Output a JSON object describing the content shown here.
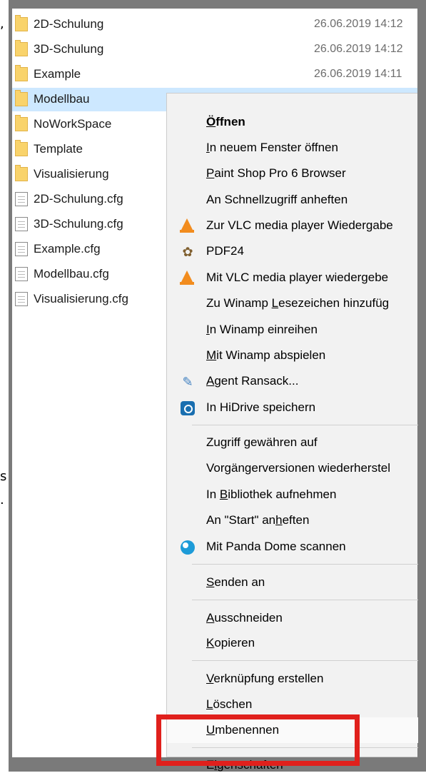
{
  "files": [
    {
      "name": "2D-Schulung",
      "type": "folder",
      "date": "26.06.2019 14:12",
      "selected": false
    },
    {
      "name": "3D-Schulung",
      "type": "folder",
      "date": "26.06.2019 14:12",
      "selected": false
    },
    {
      "name": "Example",
      "type": "folder",
      "date": "26.06.2019 14:11",
      "selected": false
    },
    {
      "name": "Modellbau",
      "type": "folder",
      "date": "",
      "selected": true
    },
    {
      "name": "NoWorkSpace",
      "type": "folder",
      "date": "",
      "selected": false
    },
    {
      "name": "Template",
      "type": "folder",
      "date": "",
      "selected": false
    },
    {
      "name": "Visualisierung",
      "type": "folder",
      "date": "",
      "selected": false
    },
    {
      "name": "2D-Schulung.cfg",
      "type": "file",
      "date": "",
      "selected": false
    },
    {
      "name": "3D-Schulung.cfg",
      "type": "file",
      "date": "",
      "selected": false
    },
    {
      "name": "Example.cfg",
      "type": "file",
      "date": "",
      "selected": false
    },
    {
      "name": "Modellbau.cfg",
      "type": "file",
      "date": "",
      "selected": false
    },
    {
      "name": "Visualisierung.cfg",
      "type": "file",
      "date": "",
      "selected": false
    }
  ],
  "context_menu": {
    "items": [
      {
        "label": "Öffnen",
        "access_key": "Ö",
        "bold": true,
        "icon": ""
      },
      {
        "label": "In neuem Fenster öffnen",
        "access_key": "I",
        "icon": ""
      },
      {
        "label": "Paint Shop Pro 6 Browser",
        "access_key": "P",
        "icon": ""
      },
      {
        "label": "An Schnellzugriff anheften",
        "access_key": "",
        "icon": ""
      },
      {
        "label": "Zur VLC media player Wiedergabe",
        "access_key": "",
        "icon": "vlc-icon"
      },
      {
        "label": "PDF24",
        "access_key": "",
        "icon": "pdf24-icon"
      },
      {
        "label": "Mit VLC media player wiedergebe",
        "access_key": "",
        "icon": "vlc-icon"
      },
      {
        "label": "Zu Winamp Lesezeichen hinzufüg",
        "access_key": "L",
        "icon": ""
      },
      {
        "label": "In Winamp einreihen",
        "access_key": "I",
        "icon": ""
      },
      {
        "label": "Mit Winamp abspielen",
        "access_key": "M",
        "icon": ""
      },
      {
        "label": "Agent Ransack...",
        "access_key": "A",
        "icon": "agent-ransack-icon"
      },
      {
        "label": "In HiDrive speichern",
        "access_key": "",
        "icon": "hidrive-icon"
      },
      {
        "label": "Zugriff gewähren auf",
        "access_key": "",
        "icon": ""
      },
      {
        "label": "Vorgängerversionen wiederherstel",
        "access_key": "g",
        "icon": ""
      },
      {
        "label": "In Bibliothek aufnehmen",
        "access_key": "B",
        "icon": ""
      },
      {
        "label": "An \"Start\" anheften",
        "access_key": "h",
        "icon": ""
      },
      {
        "label": "Mit Panda Dome scannen",
        "access_key": "",
        "icon": "panda-dome-icon"
      },
      {
        "label": "Senden an",
        "access_key": "S",
        "icon": ""
      },
      {
        "label": "Ausschneiden",
        "access_key": "A",
        "icon": ""
      },
      {
        "label": "Kopieren",
        "access_key": "K",
        "icon": ""
      },
      {
        "label": "Verknüpfung erstellen",
        "access_key": "V",
        "icon": ""
      },
      {
        "label": "Löschen",
        "access_key": "L",
        "icon": ""
      },
      {
        "label": "Umbenennen",
        "access_key": "U",
        "icon": "",
        "hovered": true
      },
      {
        "label": "Eigenschaften",
        "access_key": "i",
        "icon": "",
        "highlighted": true
      }
    ]
  },
  "edge_glyphs": [
    ",",
    "s",
    "."
  ],
  "colors": {
    "selection": "#cde8ff",
    "menu_background": "#f2f2f2",
    "highlight_box": "#e0201c",
    "frame": "#7a7a7a"
  }
}
